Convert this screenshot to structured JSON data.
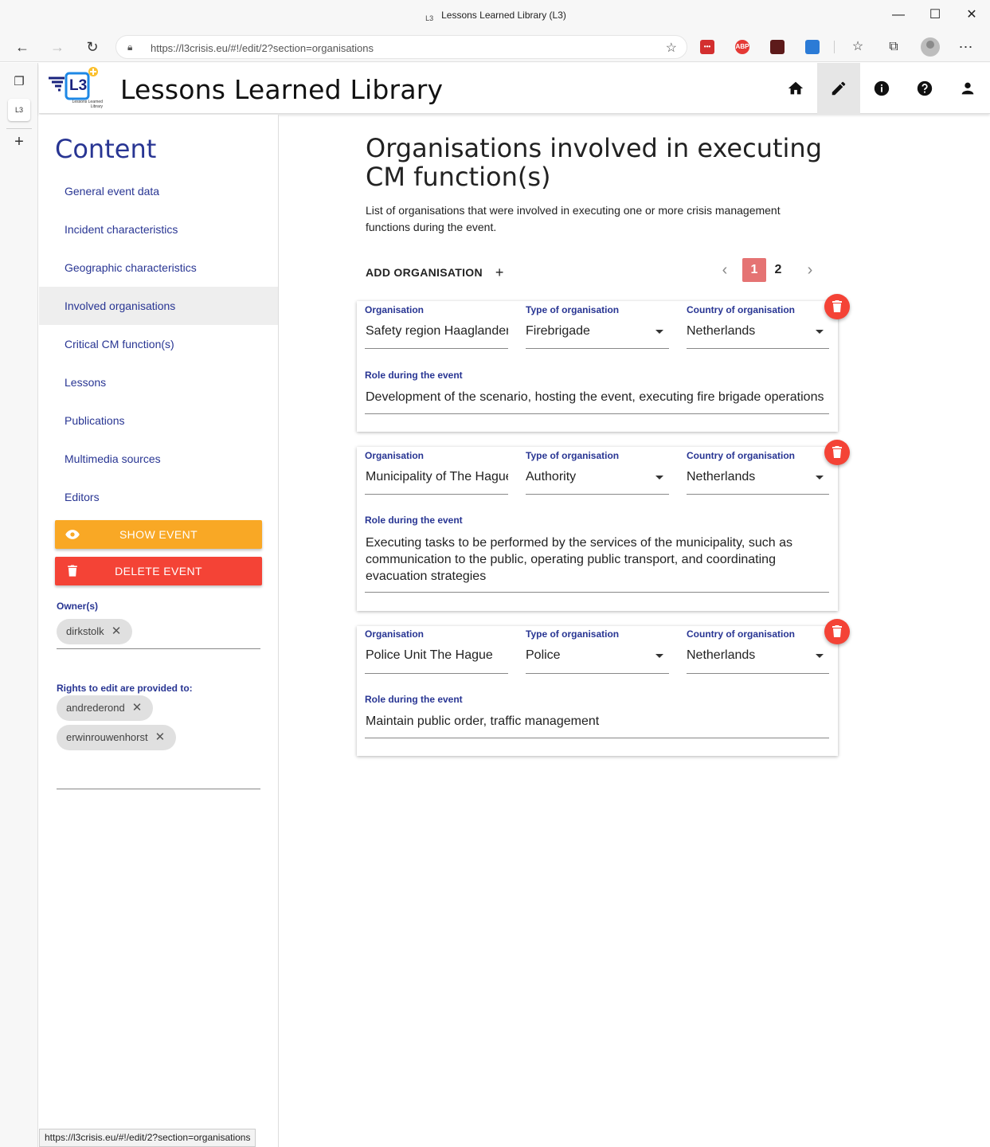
{
  "window": {
    "title": "Lessons Learned Library (L3)",
    "favicon_text": "L3",
    "minimize": "—",
    "maximize": "☐",
    "close": "✕"
  },
  "browser": {
    "url": "https://l3crisis.eu/#!/edit/2?section=organisations",
    "ext_labels": [
      "•••",
      "ABP",
      "",
      ""
    ]
  },
  "app": {
    "title": "Lessons Learned Library",
    "logo_text": "L3",
    "logo_caption": "Lessons Learned Library"
  },
  "sidebar": {
    "heading": "Content",
    "items": [
      {
        "label": "General event data"
      },
      {
        "label": "Incident characteristics"
      },
      {
        "label": "Geographic characteristics"
      },
      {
        "label": "Involved organisations",
        "active": true
      },
      {
        "label": "Critical CM function(s)"
      },
      {
        "label": "Lessons"
      },
      {
        "label": "Publications"
      },
      {
        "label": "Multimedia sources"
      },
      {
        "label": "Editors"
      }
    ],
    "show_event": "SHOW EVENT",
    "delete_event": "DELETE EVENT",
    "owners_label": "Owner(s)",
    "owners": [
      "dirkstolk"
    ],
    "rights_label": "Rights to edit are provided to:",
    "rights": [
      "andrederond",
      "erwinrouwenhorst"
    ]
  },
  "main": {
    "title": "Organisations involved in executing CM function(s)",
    "description": "List of organisations that were involved in executing one or more crisis management functions during the event.",
    "add_label": "ADD ORGANISATION",
    "pagination": {
      "current": "1",
      "next_page": "2"
    },
    "field_labels": {
      "organisation": "Organisation",
      "type": "Type of organisation",
      "country": "Country of organisation",
      "role": "Role during the event"
    },
    "organisations": [
      {
        "name": "Safety region Haaglanden",
        "type": "Firebrigade",
        "country": "Netherlands",
        "role": "Development of the scenario, hosting the event, executing fire brigade operations"
      },
      {
        "name": "Municipality of The Hague",
        "type": "Authority",
        "country": "Netherlands",
        "role": "Executing tasks to be performed by the services of the municipality, such as communication to the public, operating public transport, and coordinating evacuation strategies"
      },
      {
        "name": "Police Unit The Hague",
        "type": "Police",
        "country": "Netherlands",
        "role": "Maintain public order, traffic management"
      }
    ]
  },
  "statusbar": {
    "text": "https://l3crisis.eu/#!/edit/2?section=organisations"
  },
  "colors": {
    "accent_navy": "#283593",
    "show_event": "#f9a825",
    "delete": "#f44336",
    "pager_active": "#e57373"
  }
}
